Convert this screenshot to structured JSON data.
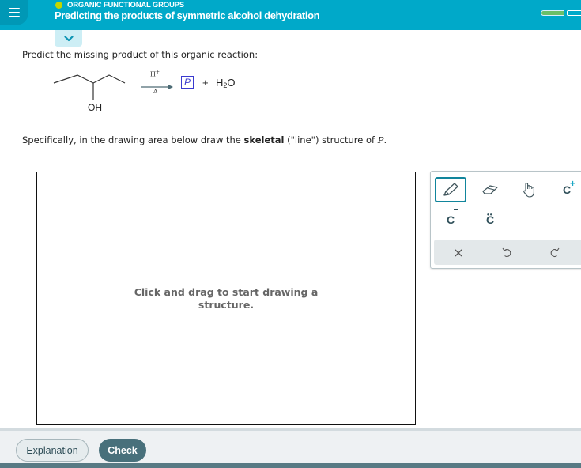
{
  "header": {
    "topic": "ORGANIC FUNCTIONAL GROUPS",
    "title": "Predicting the products of symmetric alcohol dehydration",
    "menu_icon": "hamburger-menu-icon",
    "progress": {
      "segments_total": 2,
      "segments_filled": 1
    },
    "colors": {
      "bar": "#00a9c9",
      "topic_dot": "#c3d600",
      "progress_fill": "#6abf69"
    }
  },
  "collapse_icon": "chevron-down-icon",
  "question": {
    "prompt": "Predict the missing product of this organic reaction:",
    "reaction": {
      "reactant_label": "OH",
      "reagent_top": "H",
      "reagent_top_sup": "+",
      "reagent_bottom": "Δ",
      "product_placeholder": "P",
      "plus": "+",
      "byproduct_main": "H",
      "byproduct_sub": "2",
      "byproduct_tail": "O"
    },
    "instruction_pre": "Specifically, in the drawing area below draw the ",
    "instruction_bold": "skeletal",
    "instruction_mid": " (\"line\") structure of ",
    "instruction_var": "P",
    "instruction_end": "."
  },
  "canvas": {
    "hint_line1": "Click and drag to start drawing a",
    "hint_line2": "structure."
  },
  "toolbar": {
    "tools": [
      {
        "name": "pencil",
        "icon": "pencil-icon",
        "active": true
      },
      {
        "name": "eraser",
        "icon": "eraser-icon",
        "active": false
      },
      {
        "name": "hand",
        "icon": "hand-icon",
        "active": false
      },
      {
        "name": "positive-charge",
        "label": "C",
        "sup": "+",
        "active": false
      },
      {
        "name": "negative-charge",
        "label": "C",
        "active": false
      },
      {
        "name": "lone-pair",
        "label": "C",
        "dots": "••",
        "active": false
      }
    ],
    "actions": [
      {
        "name": "clear",
        "glyph": "×"
      },
      {
        "name": "undo",
        "icon": "undo-icon"
      },
      {
        "name": "redo",
        "icon": "redo-icon"
      }
    ]
  },
  "footer": {
    "explanation_label": "Explanation",
    "check_label": "Check"
  }
}
